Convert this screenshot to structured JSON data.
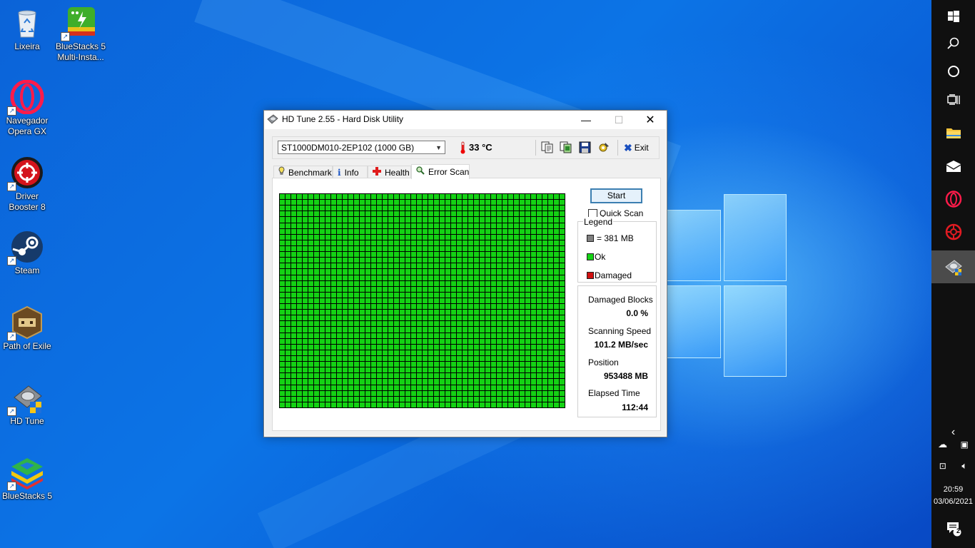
{
  "desktop": {
    "icons": [
      {
        "label": "Lixeira",
        "icon": "recycle-bin-icon"
      },
      {
        "label": "BlueStacks 5 Multi-Insta...",
        "icon": "bluestacks-multi-instance-icon"
      },
      {
        "label": "Navegador Opera GX",
        "icon": "opera-gx-icon"
      },
      {
        "label": "Driver Booster 8",
        "icon": "driver-booster-icon"
      },
      {
        "label": "Steam",
        "icon": "steam-icon"
      },
      {
        "label": "Path of Exile",
        "icon": "path-of-exile-icon"
      },
      {
        "label": "HD Tune",
        "icon": "hd-tune-icon"
      },
      {
        "label": "BlueStacks 5",
        "icon": "bluestacks-icon"
      }
    ]
  },
  "window": {
    "title": "HD Tune 2.55 - Hard Disk Utility",
    "controls": {
      "minimize": "—",
      "maximize": "☐",
      "close": "✕"
    },
    "toolbar": {
      "drive": "ST1000DM010-2EP102 (1000 GB)",
      "temperature": "33 °C",
      "exit_label": "Exit"
    },
    "tabs": [
      {
        "label": "Benchmark",
        "icon": "benchmark-icon"
      },
      {
        "label": "Info",
        "icon": "info-icon"
      },
      {
        "label": "Health",
        "icon": "health-icon"
      },
      {
        "label": "Error Scan",
        "icon": "magnifier-icon",
        "selected": true
      }
    ],
    "error_scan": {
      "start_label": "Start",
      "quick_scan_label": "Quick Scan",
      "quick_scan_checked": false,
      "legend": {
        "title": "Legend",
        "block_size": "= 381 MB",
        "ok": "Ok",
        "damaged": "Damaged",
        "colors": {
          "block": "#808080",
          "ok": "#14d214",
          "damaged": "#d01010"
        }
      },
      "stats": {
        "damaged_blocks_label": "Damaged Blocks",
        "damaged_blocks_value": "0.0 %",
        "scanning_speed_label": "Scanning Speed",
        "scanning_speed_value": "101.2 MB/sec",
        "position_label": "Position",
        "position_value": "953488 MB",
        "elapsed_label": "Elapsed Time",
        "elapsed_value": "112:44"
      },
      "grid": {
        "columns": 50,
        "rows": 37,
        "status": "ok"
      }
    }
  },
  "taskbar": {
    "notification_count": "2",
    "time": "20:59",
    "date": "03/06/2021"
  }
}
